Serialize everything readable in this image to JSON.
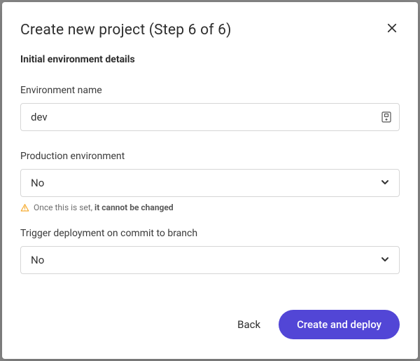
{
  "modal": {
    "title": "Create new project (Step 6 of 6)"
  },
  "section": {
    "title": "Initial environment details"
  },
  "form": {
    "env_name": {
      "label": "Environment name",
      "value": "dev"
    },
    "production": {
      "label": "Production environment",
      "value": "No",
      "warning_prefix": "Once this is set, ",
      "warning_emph": "it cannot be changed"
    },
    "trigger": {
      "label": "Trigger deployment on commit to branch",
      "value": "No"
    }
  },
  "footer": {
    "back": "Back",
    "submit": "Create and deploy"
  }
}
